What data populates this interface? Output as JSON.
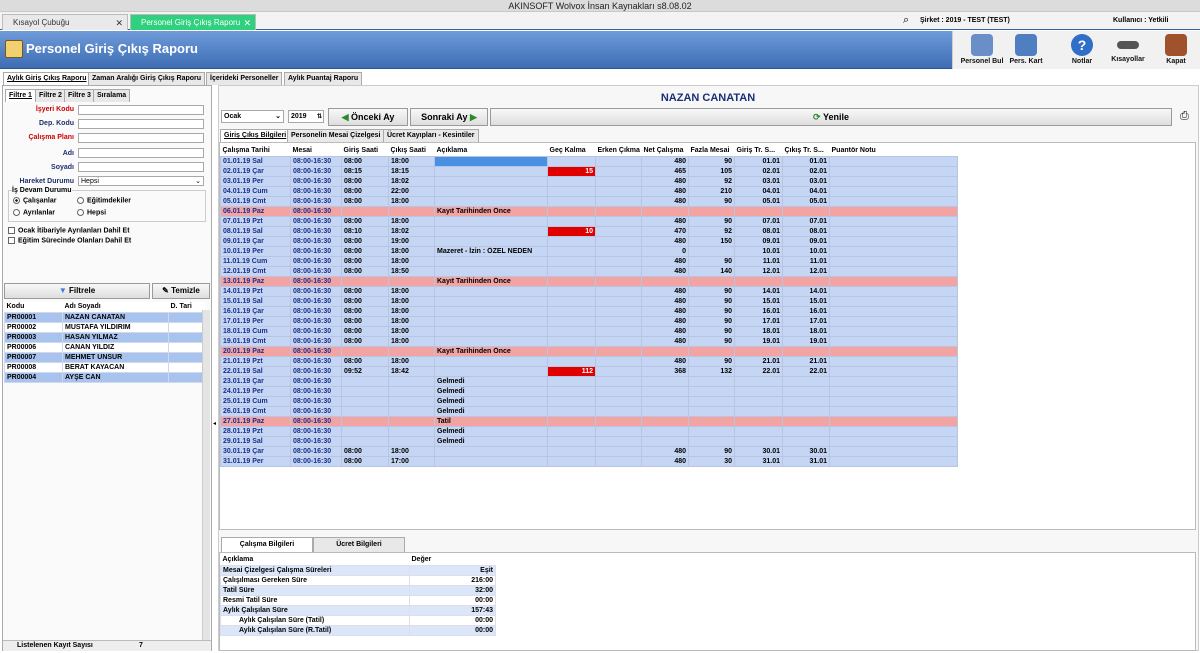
{
  "app": {
    "title": "AKINSOFT Wolvox İnsan Kaynakları s8.08.02",
    "sirket": "Şirket : 2019 - TEST (TEST)",
    "kullanici": "Kullanıcı : Yetkili"
  },
  "tabs": [
    {
      "label": "Kısayol Çubuğu"
    },
    {
      "label": "Personel Giriş Çıkış Raporu"
    }
  ],
  "page_title": "Personel Giriş Çıkış Raporu",
  "toolbar": [
    {
      "label": "Personel Bul",
      "icon": "person-search-icon"
    },
    {
      "label": "Pers. Kart",
      "icon": "person-card-icon"
    },
    {
      "label": "Notlar",
      "icon": "help-icon"
    },
    {
      "label": "Kısayollar",
      "icon": "shortcut-icon"
    },
    {
      "label": "Kapat",
      "icon": "exit-door-icon"
    }
  ],
  "report_tabs": [
    "Aylık Giriş Çıkış Raporu",
    "Zaman Aralığı Giriş Çıkış Raporu",
    "İçerideki Personeller",
    "Aylık Puantaj Raporu"
  ],
  "filter_tabs": [
    "Filtre 1",
    "Filtre 2",
    "Filtre 3",
    "Sıralama"
  ],
  "filter": {
    "isyeri": "İşyeri Kodu",
    "dep": "Dep. Kodu",
    "plan": "Çalışma Planı",
    "adi": "Adı",
    "soyadi": "Soyadı",
    "hareket": "Hareket Durumu",
    "hareket_value": "Hepsi",
    "devam_title": "İş Devam Durumu",
    "r_calisan": "Çalışanlar",
    "r_egitim": "Eğitimdekiler",
    "r_ayrilan": "Ayrılanlar",
    "r_hepsi": "Hepsi",
    "c_ocak": "Ocak İtibariyle Ayrılanları Dahil Et",
    "c_egitim": "Eğitim Sürecinde Olanları Dahil Et"
  },
  "buttons": {
    "filtrele": "Filtrele",
    "temizle": "Temizle",
    "onceki": "Önceki Ay",
    "sonraki": "Sonraki Ay",
    "yenile": "Yenile"
  },
  "person_list": {
    "headers": [
      "Kodu",
      "Adı Soyadı",
      "D. Tari"
    ],
    "rows": [
      [
        "PR00001",
        "NAZAN CANATAN"
      ],
      [
        "PR00002",
        "MUSTAFA YILDIRIM"
      ],
      [
        "PR00003",
        "HASAN YILMAZ"
      ],
      [
        "PR00006",
        "CANAN YILDIZ"
      ],
      [
        "PR00007",
        "MEHMET UNSUR"
      ],
      [
        "PR00008",
        "BERAT KAYACAN"
      ],
      [
        "PR00004",
        "AYŞE CAN"
      ]
    ],
    "count_label": "Listelenen Kayıt Sayısı",
    "count": "7"
  },
  "selected_name": "NAZAN CANATAN",
  "month": "Ocak",
  "year": "2019",
  "detail_tabs": [
    "Giriş Çıkış Bilgileri",
    "Personelin Mesai Çizelgesi",
    "Ücret Kayıpları - Kesintiler"
  ],
  "grid": {
    "headers": [
      "Çalışma Tarihi",
      "Mesai",
      "Giriş Saati",
      "Çıkış Saati",
      "Açıklama",
      "Geç Kalma",
      "Erken Çıkma",
      "Net Çalışma",
      "Fazla Mesai",
      "Giriş Tr. S...",
      "Çıkış Tr. S...",
      "Puantör Notu"
    ],
    "rows": [
      {
        "t": "wd",
        "c": [
          "01.01.19 Sal",
          "08:00-16:30",
          "08:00",
          "18:00",
          "",
          "",
          "",
          "480",
          "90",
          "01.01",
          "01.01",
          ""
        ],
        "blue": true
      },
      {
        "t": "wd",
        "c": [
          "02.01.19 Çar",
          "08:00-16:30",
          "08:15",
          "18:15",
          "",
          "15",
          "",
          "465",
          "105",
          "02.01",
          "02.01",
          ""
        ],
        "red": true
      },
      {
        "t": "wd",
        "c": [
          "03.01.19 Per",
          "08:00-16:30",
          "08:00",
          "18:02",
          "",
          "",
          "",
          "480",
          "92",
          "03.01",
          "03.01",
          ""
        ]
      },
      {
        "t": "wd",
        "c": [
          "04.01.19 Cum",
          "08:00-16:30",
          "08:00",
          "22:00",
          "",
          "",
          "",
          "480",
          "210",
          "04.01",
          "04.01",
          ""
        ]
      },
      {
        "t": "wd",
        "c": [
          "05.01.19 Cmt",
          "08:00-16:30",
          "08:00",
          "18:00",
          "",
          "",
          "",
          "480",
          "90",
          "05.01",
          "05.01",
          ""
        ]
      },
      {
        "t": "we",
        "c": [
          "06.01.19 Paz",
          "08:00-16:30",
          "",
          "",
          "Kayıt Tarihinden Önce",
          "",
          "",
          "",
          "",
          "",
          "",
          ""
        ]
      },
      {
        "t": "wd",
        "c": [
          "07.01.19 Pzt",
          "08:00-16:30",
          "08:00",
          "18:00",
          "",
          "",
          "",
          "480",
          "90",
          "07.01",
          "07.01",
          ""
        ]
      },
      {
        "t": "wd",
        "c": [
          "08.01.19 Sal",
          "08:00-16:30",
          "08:10",
          "18:02",
          "",
          "10",
          "",
          "470",
          "92",
          "08.01",
          "08.01",
          ""
        ],
        "red": true
      },
      {
        "t": "wd",
        "c": [
          "09.01.19 Çar",
          "08:00-16:30",
          "08:00",
          "19:00",
          "",
          "",
          "",
          "480",
          "150",
          "09.01",
          "09.01",
          ""
        ]
      },
      {
        "t": "wd",
        "c": [
          "10.01.19 Per",
          "08:00-16:30",
          "08:00",
          "18:00",
          "Mazeret - İzin : ÖZEL NEDEN",
          "",
          "",
          "0",
          "",
          "10.01",
          "10.01",
          ""
        ]
      },
      {
        "t": "wd",
        "c": [
          "11.01.19 Cum",
          "08:00-16:30",
          "08:00",
          "18:00",
          "",
          "",
          "",
          "480",
          "90",
          "11.01",
          "11.01",
          ""
        ]
      },
      {
        "t": "wd",
        "c": [
          "12.01.19 Cmt",
          "08:00-16:30",
          "08:00",
          "18:50",
          "",
          "",
          "",
          "480",
          "140",
          "12.01",
          "12.01",
          ""
        ]
      },
      {
        "t": "we",
        "c": [
          "13.01.19 Paz",
          "08:00-16:30",
          "",
          "",
          "Kayıt Tarihinden Önce",
          "",
          "",
          "",
          "",
          "",
          "",
          ""
        ]
      },
      {
        "t": "wd",
        "c": [
          "14.01.19 Pzt",
          "08:00-16:30",
          "08:00",
          "18:00",
          "",
          "",
          "",
          "480",
          "90",
          "14.01",
          "14.01",
          ""
        ]
      },
      {
        "t": "wd",
        "c": [
          "15.01.19 Sal",
          "08:00-16:30",
          "08:00",
          "18:00",
          "",
          "",
          "",
          "480",
          "90",
          "15.01",
          "15.01",
          ""
        ]
      },
      {
        "t": "wd",
        "c": [
          "16.01.19 Çar",
          "08:00-16:30",
          "08:00",
          "18:00",
          "",
          "",
          "",
          "480",
          "90",
          "16.01",
          "16.01",
          ""
        ]
      },
      {
        "t": "wd",
        "c": [
          "17.01.19 Per",
          "08:00-16:30",
          "08:00",
          "18:00",
          "",
          "",
          "",
          "480",
          "90",
          "17.01",
          "17.01",
          ""
        ]
      },
      {
        "t": "wd",
        "c": [
          "18.01.19 Cum",
          "08:00-16:30",
          "08:00",
          "18:00",
          "",
          "",
          "",
          "480",
          "90",
          "18.01",
          "18.01",
          ""
        ]
      },
      {
        "t": "wd",
        "c": [
          "19.01.19 Cmt",
          "08:00-16:30",
          "08:00",
          "18:00",
          "",
          "",
          "",
          "480",
          "90",
          "19.01",
          "19.01",
          ""
        ]
      },
      {
        "t": "we",
        "c": [
          "20.01.19 Paz",
          "08:00-16:30",
          "",
          "",
          "Kayıt Tarihinden Önce",
          "",
          "",
          "",
          "",
          "",
          "",
          ""
        ]
      },
      {
        "t": "wd",
        "c": [
          "21.01.19 Pzt",
          "08:00-16:30",
          "08:00",
          "18:00",
          "",
          "",
          "",
          "480",
          "90",
          "21.01",
          "21.01",
          ""
        ]
      },
      {
        "t": "wd",
        "c": [
          "22.01.19 Sal",
          "08:00-16:30",
          "09:52",
          "18:42",
          "",
          "112",
          "",
          "368",
          "132",
          "22.01",
          "22.01",
          ""
        ],
        "red": true
      },
      {
        "t": "wd",
        "c": [
          "23.01.19 Çar",
          "08:00-16:30",
          "",
          "",
          "Gelmedi",
          "",
          "",
          "",
          "",
          "",
          "",
          ""
        ]
      },
      {
        "t": "wd",
        "c": [
          "24.01.19 Per",
          "08:00-16:30",
          "",
          "",
          "Gelmedi",
          "",
          "",
          "",
          "",
          "",
          "",
          ""
        ]
      },
      {
        "t": "wd",
        "c": [
          "25.01.19 Cum",
          "08:00-16:30",
          "",
          "",
          "Gelmedi",
          "",
          "",
          "",
          "",
          "",
          "",
          ""
        ]
      },
      {
        "t": "wd",
        "c": [
          "26.01.19 Cmt",
          "08:00-16:30",
          "",
          "",
          "Gelmedi",
          "",
          "",
          "",
          "",
          "",
          "",
          ""
        ]
      },
      {
        "t": "we",
        "c": [
          "27.01.19 Paz",
          "08:00-16:30",
          "",
          "",
          "Tatil",
          "",
          "",
          "",
          "",
          "",
          "",
          ""
        ]
      },
      {
        "t": "wd",
        "c": [
          "28.01.19 Pzt",
          "08:00-16:30",
          "",
          "",
          "Gelmedi",
          "",
          "",
          "",
          "",
          "",
          "",
          ""
        ]
      },
      {
        "t": "wd",
        "c": [
          "29.01.19 Sal",
          "08:00-16:30",
          "",
          "",
          "Gelmedi",
          "",
          "",
          "",
          "",
          "",
          "",
          ""
        ]
      },
      {
        "t": "wd",
        "c": [
          "30.01.19 Çar",
          "08:00-16:30",
          "08:00",
          "18:00",
          "",
          "",
          "",
          "480",
          "90",
          "30.01",
          "30.01",
          ""
        ]
      },
      {
        "t": "wd",
        "c": [
          "31.01.19 Per",
          "08:00-16:30",
          "08:00",
          "17:00",
          "",
          "",
          "",
          "480",
          "30",
          "31.01",
          "31.01",
          ""
        ]
      }
    ]
  },
  "bottom_tabs": [
    "Çalışma Bilgileri",
    "Ücret Bilgileri"
  ],
  "summary": {
    "headers": [
      "Açıklama",
      "Değer"
    ],
    "rows": [
      [
        "Mesai Çizelgesi Çalışma Süreleri",
        "Eşit"
      ],
      [
        "Çalışılması Gereken Süre",
        "216:00"
      ],
      [
        "Tatil Süre",
        "32:00"
      ],
      [
        "Resmi Tatil Süre",
        "00:00"
      ],
      [
        "Aylık Çalışılan Süre",
        "157:43"
      ],
      [
        "Aylık Çalışılan Süre (Tatil)",
        "00:00"
      ],
      [
        "Aylık Çalışılan Süre (R.Tatil)",
        "00:00"
      ]
    ]
  },
  "colors": {
    "header_blue": "#3e6db5",
    "weekday": "#c4d6f4",
    "weekend": "#f4a3a3",
    "late": "#e00000",
    "tab_active": "#2fd07e"
  }
}
